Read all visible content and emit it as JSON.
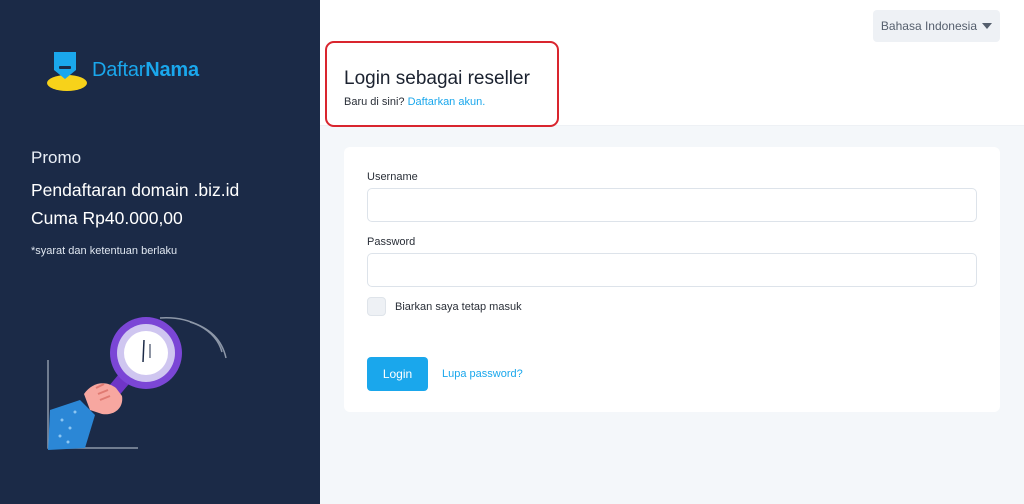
{
  "sidebar": {
    "logo": {
      "part1": "Daftar",
      "part2": "Nama"
    },
    "promo_label": "Promo",
    "promo_line1": "Pendaftaran domain .biz.id",
    "promo_line2": "Cuma Rp40.000,00",
    "promo_note": "*syarat dan ketentuan berlaku"
  },
  "topbar": {
    "language": "Bahasa Indonesia"
  },
  "header": {
    "title": "Login sebagai reseller",
    "subtitle_prefix": "Baru di sini?",
    "register_link": "Daftarkan akun."
  },
  "form": {
    "username_label": "Username",
    "username_value": "",
    "password_label": "Password",
    "password_value": "",
    "remember_label": "Biarkan saya tetap masuk",
    "remember_checked": false,
    "login_button": "Login",
    "forgot_link": "Lupa password?"
  },
  "colors": {
    "sidebar_bg": "#1b2a47",
    "accent": "#1aa7ec",
    "highlight_border": "#d9252e",
    "logo_yellow": "#f7d21a"
  }
}
